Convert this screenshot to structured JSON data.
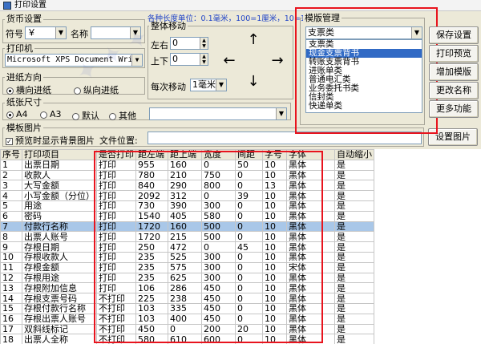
{
  "window": {
    "title": "打印设置"
  },
  "currency": {
    "group_label": "货币设置",
    "symbol_label": "符号",
    "symbol_value": "￥",
    "name_label": "名称",
    "name_value": ""
  },
  "printer": {
    "group_label": "打印机",
    "value": "Microsoft XPS Document Wri"
  },
  "direction": {
    "group_label": "进纸方向",
    "options": [
      "横向进纸",
      "纵向进纸"
    ],
    "selected": 0
  },
  "paper": {
    "group_label": "纸张尺寸",
    "options": [
      "A4",
      "A3",
      "默认",
      "其他"
    ],
    "selected": 0
  },
  "template_image": {
    "group_label": "模板图片",
    "preview_label": "预览时显示背景图片",
    "path_label": "文件位置:",
    "path_value": "",
    "set_button": "设置图片"
  },
  "move": {
    "unit_note": "各种长度单位：0.1毫米，100=1厘米，10=1毫",
    "group_label": "整体移动",
    "lr_label": "左右",
    "lr_value": "0",
    "ud_label": "上下",
    "ud_value": "0",
    "step_label": "每次移动",
    "step_value": "1毫米",
    "arrows": {
      "up": "↑",
      "down": "↓",
      "left": "←",
      "right": "→"
    }
  },
  "template_mgmt": {
    "group_label": "模版管理",
    "selected": "支票类",
    "items": [
      "支票类",
      "现金支票背书",
      "转账支票背书",
      "进账单类",
      "普通电汇类",
      "业务委托书类",
      "信封类",
      "快递单类"
    ],
    "highlight_index": 1
  },
  "buttons": {
    "save": "保存设置",
    "preview": "打印预览",
    "add": "增加模版",
    "rename": "更改名称",
    "more": "更多功能"
  },
  "table": {
    "headers": [
      "序号",
      "打印项目",
      "是否打印",
      "距左端",
      "距上端",
      "宽度",
      "间距",
      "字号",
      "字体",
      "自动缩小"
    ],
    "rows": [
      [
        "1",
        "出票日期",
        "打印",
        "955",
        "160",
        "0",
        "50",
        "10",
        "黑体",
        "是"
      ],
      [
        "2",
        "收款人",
        "打印",
        "780",
        "210",
        "750",
        "0",
        "10",
        "黑体",
        "是"
      ],
      [
        "3",
        "大写金额",
        "打印",
        "840",
        "290",
        "800",
        "0",
        "13",
        "黑体",
        "是"
      ],
      [
        "4",
        "小写金额（分位）",
        "打印",
        "2092",
        "312",
        "0",
        "39",
        "10",
        "黑体",
        "是"
      ],
      [
        "5",
        "用途",
        "打印",
        "730",
        "390",
        "300",
        "0",
        "10",
        "黑体",
        "是"
      ],
      [
        "6",
        "密码",
        "打印",
        "1540",
        "405",
        "580",
        "0",
        "10",
        "黑体",
        "是"
      ],
      [
        "7",
        "付款行名称",
        "打印",
        "1720",
        "160",
        "500",
        "0",
        "10",
        "黑体",
        "是"
      ],
      [
        "8",
        "出票人账号",
        "打印",
        "1720",
        "215",
        "500",
        "0",
        "10",
        "黑体",
        "是"
      ],
      [
        "9",
        "存根日期",
        "打印",
        "250",
        "472",
        "0",
        "45",
        "10",
        "黑体",
        "是"
      ],
      [
        "10",
        "存根收款人",
        "打印",
        "235",
        "525",
        "300",
        "0",
        "10",
        "黑体",
        "是"
      ],
      [
        "11",
        "存根金额",
        "打印",
        "235",
        "575",
        "300",
        "0",
        "10",
        "宋体",
        "是"
      ],
      [
        "12",
        "存根用途",
        "打印",
        "235",
        "625",
        "300",
        "0",
        "10",
        "黑体",
        "是"
      ],
      [
        "13",
        "存根附加信息",
        "打印",
        "106",
        "286",
        "450",
        "0",
        "10",
        "黑体",
        "是"
      ],
      [
        "14",
        "存根支票号码",
        "不打印",
        "225",
        "238",
        "450",
        "0",
        "10",
        "黑体",
        "是"
      ],
      [
        "15",
        "存根付款行名称",
        "不打印",
        "103",
        "335",
        "450",
        "0",
        "10",
        "黑体",
        "是"
      ],
      [
        "16",
        "存根出票人账号",
        "不打印",
        "103",
        "400",
        "450",
        "0",
        "10",
        "黑体",
        "是"
      ],
      [
        "17",
        "双斜线标记",
        "不打印",
        "450",
        "0",
        "200",
        "20",
        "10",
        "黑体",
        "是"
      ],
      [
        "18",
        "出票人全称",
        "不打印",
        "580",
        "610",
        "600",
        "0",
        "10",
        "黑体",
        "是"
      ]
    ],
    "highlight_row": 6
  }
}
